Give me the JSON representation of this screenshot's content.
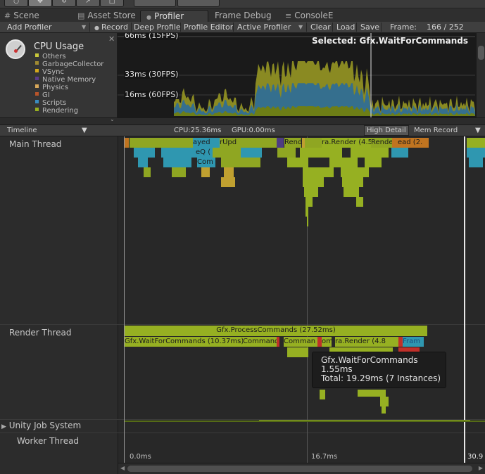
{
  "tabs": [
    {
      "icon": "#",
      "label": "Scene"
    },
    {
      "icon": "",
      "label": "Asset Store"
    },
    {
      "icon": "●",
      "label": "Profiler"
    },
    {
      "icon": "",
      "label": "Frame Debug"
    },
    {
      "icon": "≡",
      "label": "ConsoleE"
    }
  ],
  "toolbar": {
    "add_profiler": "Add Profiler",
    "record": "Record",
    "deep_profile": "Deep Profile",
    "profile_editor": "Profile Editor",
    "active_profiler": "Active Profiler",
    "clear": "Clear",
    "load": "Load",
    "save": "Save",
    "frame_label": "Frame:",
    "frame_value": "166 / 252"
  },
  "cpu": {
    "title": "CPU Usage",
    "legend": [
      {
        "label": "Others",
        "color": "#c8c83a"
      },
      {
        "label": "GarbageCollector",
        "color": "#a08a32"
      },
      {
        "label": "VSync",
        "color": "#d4a81c"
      },
      {
        "label": "Native Memory",
        "color": "#5a3c8c"
      },
      {
        "label": "Physics",
        "color": "#d8a85a"
      },
      {
        "label": "GI",
        "color": "#b8542a"
      },
      {
        "label": "Scripts",
        "color": "#3a8cc0"
      },
      {
        "label": "Rendering",
        "color": "#98b020"
      }
    ]
  },
  "graph": {
    "label_66": "66ms (15FPS)",
    "label_33": "33ms (30FPS)",
    "label_16": "16ms (60FPS)",
    "selected": "Selected: Gfx.WaitForCommands"
  },
  "timeline": {
    "view_mode": "Timeline",
    "cpu_time": "CPU:25.36ms",
    "gpu_time": "GPU:0.00ms",
    "high_detail": "High Detail",
    "mem_record": "Mem Record",
    "threads": {
      "main": "Main Thread",
      "render": "Render Thread",
      "job_system": "Unity Job System",
      "worker": "Worker Thread"
    },
    "main_labels": {
      "frag_render_a": "Rende",
      "render": "ra.Render (4.5",
      "frag_render_b": "Render",
      "frag_ead": "ead (2.",
      "frag_upd": "rUpd",
      "frag_ayed": "ayed",
      "frag_eq": "eQ (",
      "frag_com": "Com"
    },
    "render_labels": {
      "process": "Gfx.ProcessCommands (27.52ms)",
      "wait": "Gfx.WaitForCommands (10.37ms)",
      "command": "Command",
      "comman": "Comman",
      "ommands": "ommands",
      "render": "ra.Render (4.8",
      "frame": "Fram"
    },
    "tooltip": {
      "name": "Gfx.WaitForCommands",
      "self": "1.55ms",
      "total": "Total: 19.29ms (7 Instances)"
    },
    "axis": {
      "start": "0.0ms",
      "mid": "16.7ms",
      "end": "30.9"
    }
  }
}
